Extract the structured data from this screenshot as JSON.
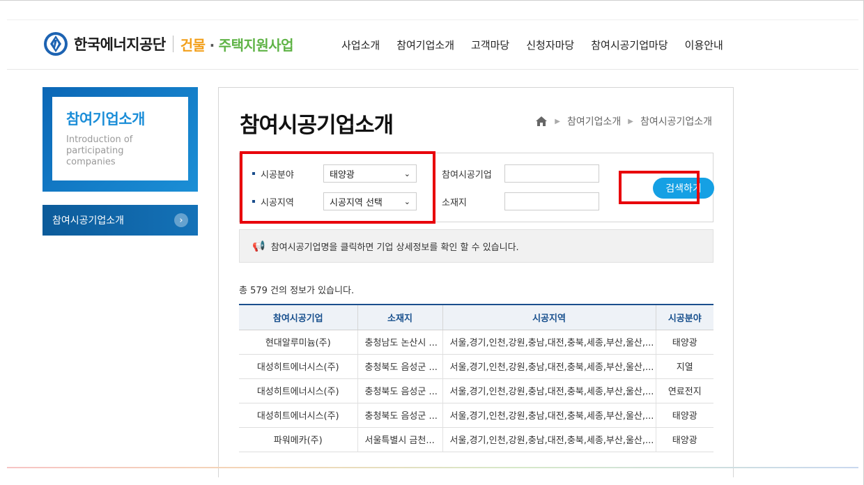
{
  "header": {
    "org_name": "한국에너지공단",
    "program_a": "건물",
    "program_dot": "·",
    "program_b": "주택지원사업",
    "nav": [
      "사업소개",
      "참여기업소개",
      "고객마당",
      "신청자마당",
      "참여시공기업마당",
      "이용안내"
    ]
  },
  "sidebar": {
    "title": "참여기업소개",
    "subtitle": "Introduction of participating companies",
    "menu_item": "참여시공기업소개",
    "menu_arrow": "›"
  },
  "main": {
    "page_title": "참여시공기업소개",
    "breadcrumb": [
      "참여기업소개",
      "참여시공기업소개"
    ],
    "search": {
      "field_label": "시공분야",
      "field_value": "태양광",
      "region_label": "시공지역",
      "region_value": "시공지역 선택",
      "company_label": "참여시공기업",
      "company_value": "",
      "location_label": "소재지",
      "location_value": "",
      "button_label": "검색하기"
    },
    "notice": "참여시공기업명을 클릭하면 기업 상세정보를 확인 할 수 있습니다.",
    "total_text": "총 579 건의 정보가 있습니다.",
    "table": {
      "headers": [
        "참여시공기업",
        "소재지",
        "시공지역",
        "시공분야"
      ],
      "rows": [
        [
          "현대알루미늄(주)",
          "충청남도 논산시 ...",
          "서울,경기,인천,강원,충남,대전,충북,세종,부산,울산,...",
          "태양광"
        ],
        [
          "대성히트에너시스(주)",
          "충청북도 음성군 ...",
          "서울,경기,인천,강원,충남,대전,충북,세종,부산,울산,...",
          "지열"
        ],
        [
          "대성히트에너시스(주)",
          "충청북도 음성군 ...",
          "서울,경기,인천,강원,충남,대전,충북,세종,부산,울산,...",
          "연료전지"
        ],
        [
          "대성히트에너시스(주)",
          "충청북도 음성군 ...",
          "서울,경기,인천,강원,충남,대전,충북,세종,부산,울산,...",
          "태양광"
        ],
        [
          "파워메카(주)",
          "서울특별시 금천...",
          "서울,경기,인천,강원,충남,대전,충북,세종,부산,울산,...",
          "태양광"
        ]
      ]
    }
  },
  "colors": {
    "brand_blue": "#1c8ed8",
    "highlight_red": "#e8000b",
    "button_blue": "#15a0e4",
    "program_orange": "#f2a01c",
    "program_green": "#5fb346"
  }
}
